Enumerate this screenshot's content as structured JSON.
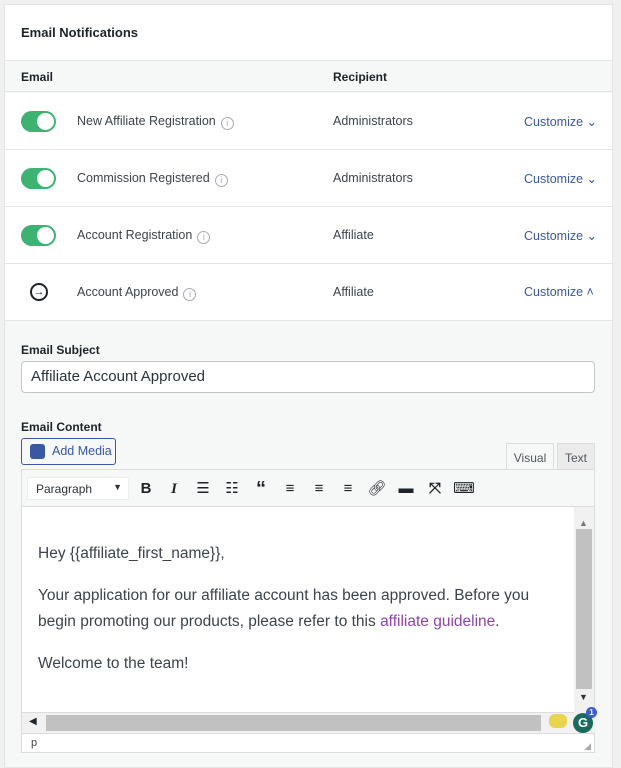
{
  "section_title": "Email Notifications",
  "table": {
    "headers": {
      "email": "Email",
      "recipient": "Recipient"
    },
    "rows": [
      {
        "name": "New Affiliate Registration",
        "recipient": "Administrators",
        "action": "Customize",
        "expanded": false,
        "enabled": true
      },
      {
        "name": "Commission Registered",
        "recipient": "Administrators",
        "action": "Customize",
        "expanded": false,
        "enabled": true
      },
      {
        "name": "Account Registration",
        "recipient": "Affiliate",
        "action": "Customize",
        "expanded": false,
        "enabled": true
      },
      {
        "name": "Account Approved",
        "recipient": "Affiliate",
        "action": "Customize",
        "expanded": true,
        "enabled": null
      }
    ]
  },
  "form": {
    "subject_label": "Email Subject",
    "subject_value": "Affiliate Account Approved",
    "content_label": "Email Content",
    "add_media": "Add Media",
    "tabs": [
      "Visual",
      "Text"
    ],
    "format_select": "Paragraph",
    "body": {
      "greeting": "Hey {{affiliate_first_name}},",
      "para1": "Your application for our affiliate account has been approved. Before you begin promoting our products, please refer to this ",
      "link": "affiliate guideline",
      "para1_end": ".",
      "para2": "Welcome to the team!"
    },
    "status_path": "p",
    "grammarly_count": "1"
  },
  "colors": {
    "toggle": "#3cb371",
    "link": "#3858a4",
    "content_link": "#8e44ad"
  }
}
